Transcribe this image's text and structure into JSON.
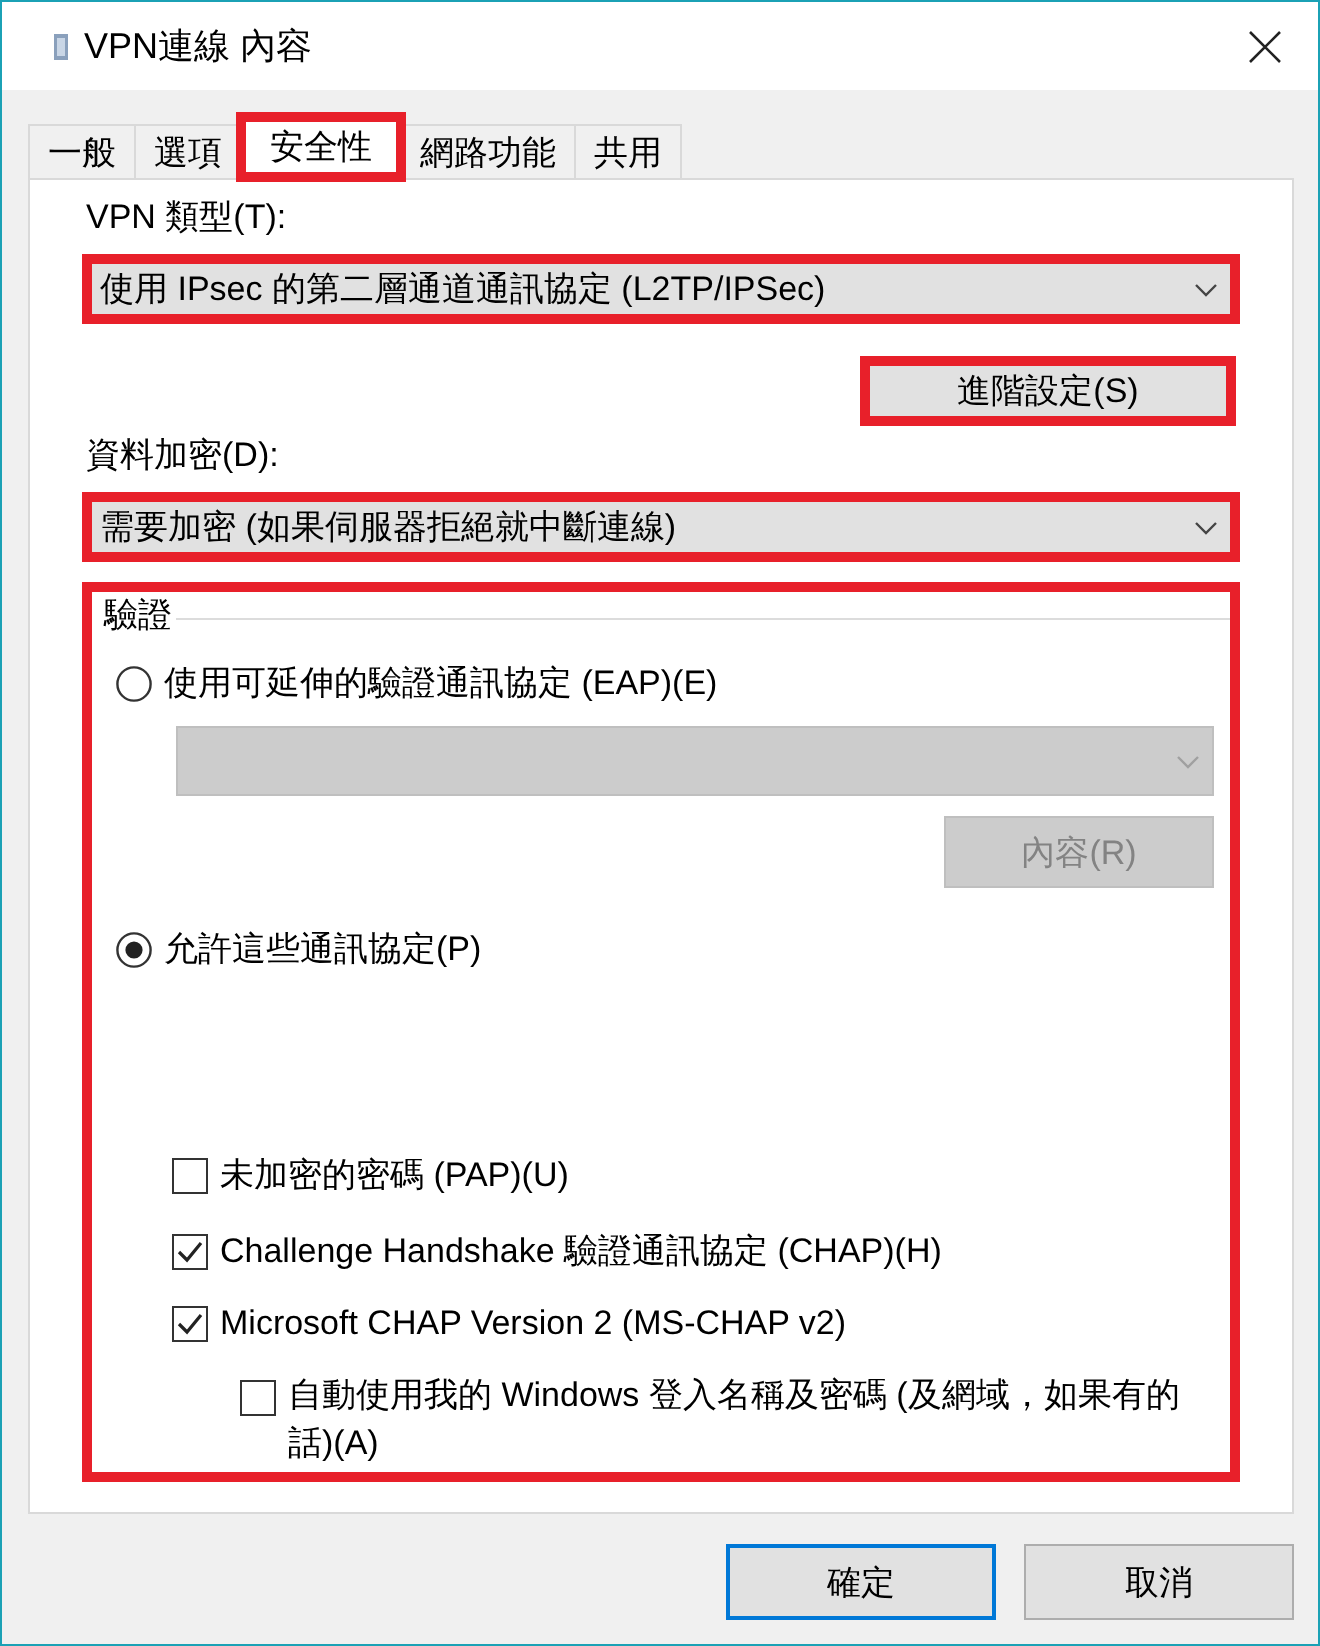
{
  "window": {
    "title": "VPN連線 內容"
  },
  "tabs": [
    {
      "label": "一般",
      "selected": false,
      "highlighted": false
    },
    {
      "label": "選項",
      "selected": false,
      "highlighted": false
    },
    {
      "label": "安全性",
      "selected": true,
      "highlighted": true
    },
    {
      "label": "網路功能",
      "selected": false,
      "highlighted": false
    },
    {
      "label": "共用",
      "selected": false,
      "highlighted": false
    }
  ],
  "vpn_type": {
    "label": "VPN 類型(T):",
    "value": "使用 IPsec 的第二層通道通訊協定 (L2TP/IPSec)",
    "highlighted": true
  },
  "advanced_button": {
    "label": "進階設定(S)",
    "highlighted": true
  },
  "encryption": {
    "label": "資料加密(D):",
    "value": "需要加密 (如果伺服器拒絕就中斷連線)",
    "highlighted": true
  },
  "authentication": {
    "title": "驗證",
    "highlighted": true,
    "eap": {
      "label": "使用可延伸的驗證通訊協定 (EAP)(E)",
      "selected": false,
      "method_dropdown": {
        "disabled": true
      },
      "properties_button": {
        "label": "內容(R)",
        "disabled": true
      }
    },
    "allow": {
      "label": "允許這些通訊協定(P)",
      "selected": true,
      "protocols": [
        {
          "label": "未加密的密碼 (PAP)(U)",
          "checked": false
        },
        {
          "label": "Challenge Handshake 驗證通訊協定 (CHAP)(H)",
          "checked": true
        },
        {
          "label": "Microsoft CHAP Version 2 (MS-CHAP v2)",
          "checked": true,
          "children": [
            {
              "label": "自動使用我的 Windows 登入名稱及密碼 (及網域，如果有的話)(A)",
              "checked": false
            }
          ]
        }
      ]
    }
  },
  "buttons": [
    {
      "label": "確定",
      "default": true
    },
    {
      "label": "取消",
      "default": false
    }
  ]
}
